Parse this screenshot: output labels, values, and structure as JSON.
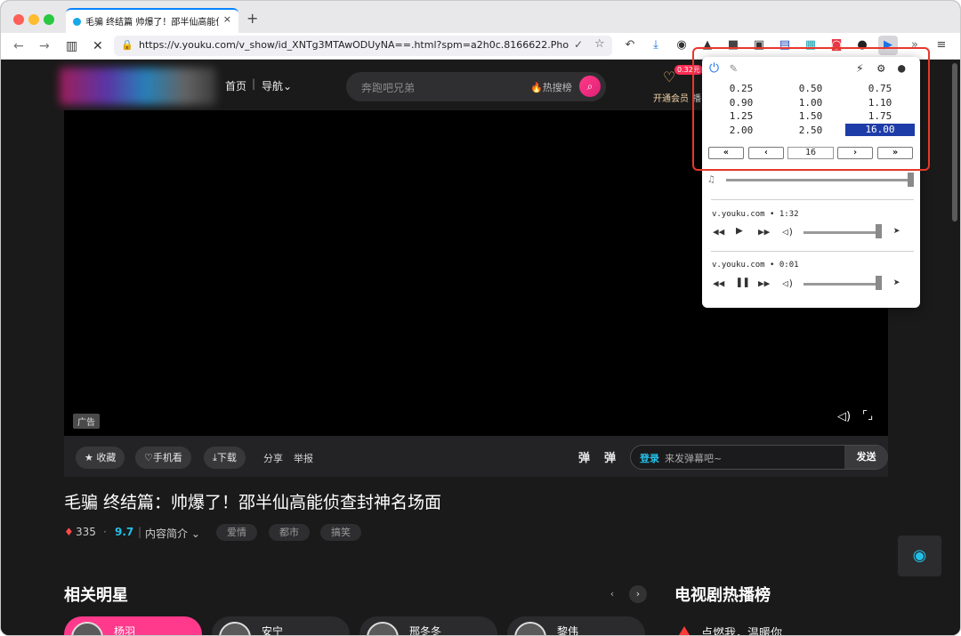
{
  "browser": {
    "tab_title": "毛骗 终结篇 帅爆了！邵半仙高能侦",
    "tab_close": "×",
    "new_tab": "+",
    "url": "https://v.youku.com/v_show/id_XNTg3MTAwODUyNA==.html?spm=a2h0c.8166622.PhoneSokuPro",
    "back": "←",
    "forward": "→",
    "reader": "▥",
    "stop": "✕",
    "lock": "🔒",
    "check": "✓",
    "star": "☆",
    "overflow": "»",
    "menu": "≡"
  },
  "header": {
    "home": "首页",
    "separator": "|",
    "nav": "导航⌄",
    "search_placeholder": "奔跑吧兄弟",
    "hot_list": "🔥热搜榜",
    "search_btn": "⌕",
    "vip_badge": "0.32元",
    "vip_label": "开通会员",
    "vip_label2": "播"
  },
  "player": {
    "ad_label": "广告",
    "volume": "◁)",
    "fullscreen": "⌜⌟"
  },
  "actions": {
    "collect": "★ 收藏",
    "phone": "♡手机看",
    "download": "⤓下载",
    "share": "分享",
    "report": "举报",
    "danmu1": "弹",
    "danmu2": "弹",
    "login": "登录",
    "danmu_placeholder": "来发弹幕吧~",
    "send": "发送"
  },
  "video": {
    "title": "毛骗 终结篇：帅爆了！邵半仙高能侦查封神名场面",
    "heat": "335",
    "dot": "·",
    "score": "9.7",
    "intro": "内容简介 ⌄",
    "tags": [
      "爱情",
      "都市",
      "搞笑"
    ]
  },
  "sections": {
    "stars_title": "相关明星",
    "prev": "‹",
    "next": "›",
    "stars": [
      "杨羽",
      "安宁",
      "邢冬冬",
      "黎伟"
    ],
    "ranking_title": "电视剧热播榜",
    "ranking_first": "点燃我，温暖你"
  },
  "popup": {
    "speeds": [
      [
        "0.25",
        "0.50",
        "0.75"
      ],
      [
        "0.90",
        "1.00",
        "1.10"
      ],
      [
        "1.25",
        "1.50",
        "1.75"
      ],
      [
        "2.00",
        "2.50",
        "16.00"
      ]
    ],
    "selected_speed": "16.00",
    "btn_first": "«",
    "btn_prev": "‹",
    "speed_input": "16",
    "btn_next": "›",
    "btn_last": "»",
    "media": [
      {
        "label": "v.youku.com • 1:32",
        "state": "paused"
      },
      {
        "label": "v.youku.com • 0:01",
        "state": "playing"
      }
    ]
  },
  "colors": {
    "accent_pink": "#ff3a8c",
    "speed_selected": "#1e3ca8",
    "highlight_border": "#e8372b"
  }
}
